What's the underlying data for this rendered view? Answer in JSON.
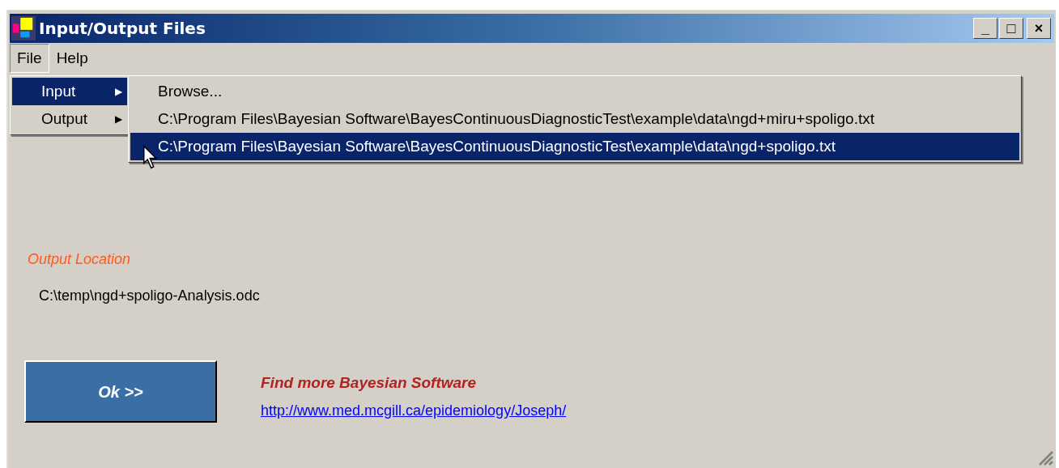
{
  "window": {
    "title": "Input/Output Files",
    "controls": [
      "_",
      "□",
      "×"
    ]
  },
  "menu_bar": [
    {
      "label": "File",
      "selected": true
    },
    {
      "label": "Help",
      "selected": false
    }
  ],
  "file_menu": [
    {
      "label": "Input",
      "selected": true,
      "submenu_arrow": "▶"
    },
    {
      "label": "Output",
      "selected": false,
      "submenu_arrow": "▶"
    }
  ],
  "input_submenu": [
    {
      "label": "Browse...",
      "selected": false
    },
    {
      "label": "C:\\Program Files\\Bayesian Software\\BayesContinuousDiagnosticTest\\example\\data\\ngd+miru+spoligo.txt",
      "selected": false
    },
    {
      "label": "C:\\Program Files\\Bayesian Software\\BayesContinuousDiagnosticTest\\example\\data\\ngd+spoligo.txt",
      "selected": true
    }
  ],
  "output_location": {
    "label": "Output Location",
    "path": "C:\\temp\\ngd+spoligo-Analysis.odc"
  },
  "ok_button": "Ok >>",
  "promo": {
    "heading": "Find more Bayesian Software",
    "link": "http://www.med.mcgill.ca/epidemiology/Joseph/"
  }
}
